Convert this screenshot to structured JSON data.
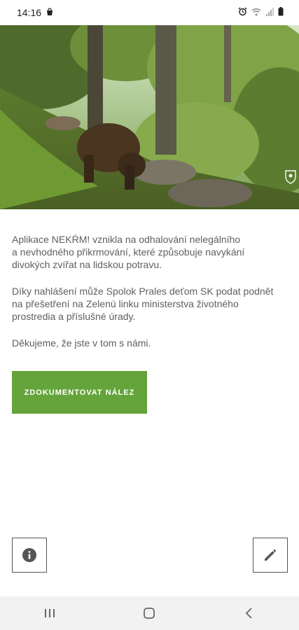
{
  "status_bar": {
    "time": "14:16",
    "left_icons": [
      "shopping-bag-icon"
    ],
    "right_icons": [
      "alarm-icon",
      "wifi-icon",
      "signal-icon",
      "battery-icon"
    ]
  },
  "hero": {
    "description_icon": "bear-photo-image",
    "watermark_icon": "shield-logo-icon"
  },
  "intro": {
    "paragraph1": "Aplikace NEKŔM! vznikla na odhalování nelegálního\na nevhodného přikrmování, které způsobuje navykání\ndivokých zvířat na lidskou potravu.",
    "paragraph2": "Díky nahlášení může Spolok Prales deťom SK podat podnět\nna přešetření na Zelenú linku ministerstva životného\nprostredia a příslušné úrady.",
    "paragraph3": "Děkujeme, že jste v tom s námi."
  },
  "cta": {
    "label": "ZDOKUMENTOVAT NÁLEZ",
    "color": "#64a43a"
  },
  "corner_buttons": {
    "info_icon": "info-icon",
    "edit_icon": "pencil-icon"
  },
  "nav": {
    "items": [
      "recent-apps-icon",
      "home-icon",
      "back-icon"
    ]
  }
}
